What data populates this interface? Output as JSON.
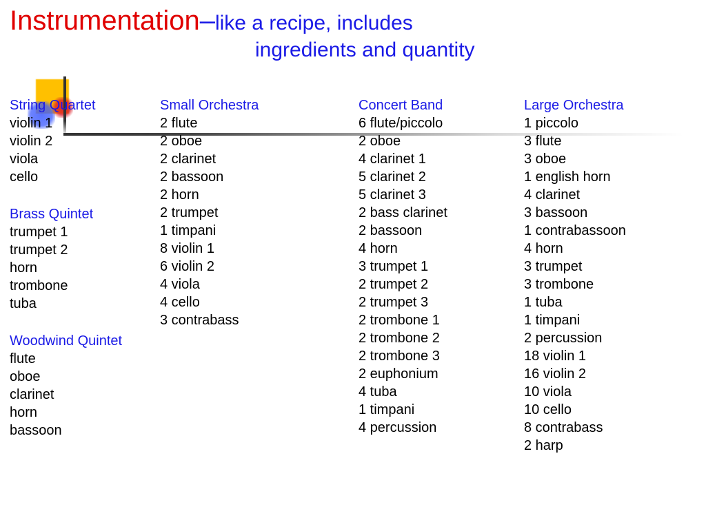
{
  "title": {
    "main": "Instrumentation",
    "dash": "–",
    "sub1": "like a recipe, includes",
    "sub2": "ingredients and quantity"
  },
  "columns": [
    {
      "groups": [
        {
          "title": "String Quartet",
          "items": [
            "violin 1",
            "violin 2",
            "viola",
            "cello"
          ]
        },
        {
          "title": "Brass Quintet",
          "items": [
            "trumpet 1",
            "trumpet 2",
            "horn",
            "trombone",
            "tuba"
          ]
        },
        {
          "title": "Woodwind Quintet",
          "items": [
            "flute",
            "oboe",
            "clarinet",
            "horn",
            "bassoon"
          ]
        }
      ]
    },
    {
      "groups": [
        {
          "title": "Small Orchestra",
          "items": [
            "2 flute",
            "2 oboe",
            "2 clarinet",
            "2 bassoon",
            "2 horn",
            "2 trumpet",
            "1 timpani",
            "8 violin 1",
            "6 violin 2",
            "4 viola",
            "4 cello",
            "3 contrabass"
          ]
        }
      ]
    },
    {
      "groups": [
        {
          "title": "Concert Band",
          "items": [
            "6 flute/piccolo",
            "2 oboe",
            "4 clarinet 1",
            "5 clarinet 2",
            "5 clarinet 3",
            "2 bass clarinet",
            "2 bassoon",
            "4 horn",
            "3 trumpet 1",
            "2 trumpet 2",
            "2 trumpet 3",
            "2 trombone 1",
            "2 trombone 2",
            "2 trombone 3",
            "2 euphonium",
            "4 tuba",
            "1 timpani",
            "4 percussion"
          ]
        }
      ]
    },
    {
      "groups": [
        {
          "title": "Large Orchestra",
          "items": [
            "1 piccolo",
            "3 flute",
            "3 oboe",
            "1 english horn",
            "4 clarinet",
            "3 bassoon",
            "1 contrabassoon",
            "4 horn",
            "3 trumpet",
            "3 trombone",
            "1 tuba",
            "1 timpani",
            "2 percussion",
            "18 violin 1",
            "16 violin 2",
            "10 viola",
            "10 cello",
            "8 contrabass",
            "2 harp"
          ]
        }
      ]
    }
  ]
}
